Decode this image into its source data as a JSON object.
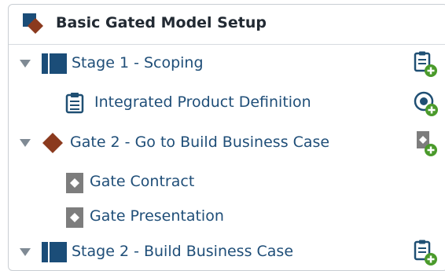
{
  "header": {
    "title": "Basic Gated Model Setup",
    "icon": "gate-diamond-icon"
  },
  "colors": {
    "stage_blue": "#1b4d78",
    "gate_brown": "#8b3a1e",
    "icon_teal": "#1f4f73",
    "add_green": "#4a9a2b",
    "deliverable_gray": "#7d7d7d"
  },
  "tree": {
    "stage1": {
      "label": "Stage 1 - Scoping",
      "icon": "stage-block-icon",
      "action_icon": "add-deliverable-icon"
    },
    "deliverable1": {
      "label": "Integrated Product Definition",
      "icon": "clipboard-icon",
      "action_icon": "add-target-icon"
    },
    "gate2": {
      "label": "Gate 2 - Go to Build Business Case",
      "icon": "gate-diamond-icon",
      "action_icon": "add-gate-document-icon"
    },
    "gate_contract": {
      "label": "Gate Contract",
      "icon": "gate-document-icon"
    },
    "gate_presentation": {
      "label": "Gate Presentation",
      "icon": "gate-document-icon"
    },
    "stage2": {
      "label": "Stage 2 - Build Business Case",
      "icon": "stage-block-icon",
      "action_icon": "add-deliverable-icon"
    }
  }
}
